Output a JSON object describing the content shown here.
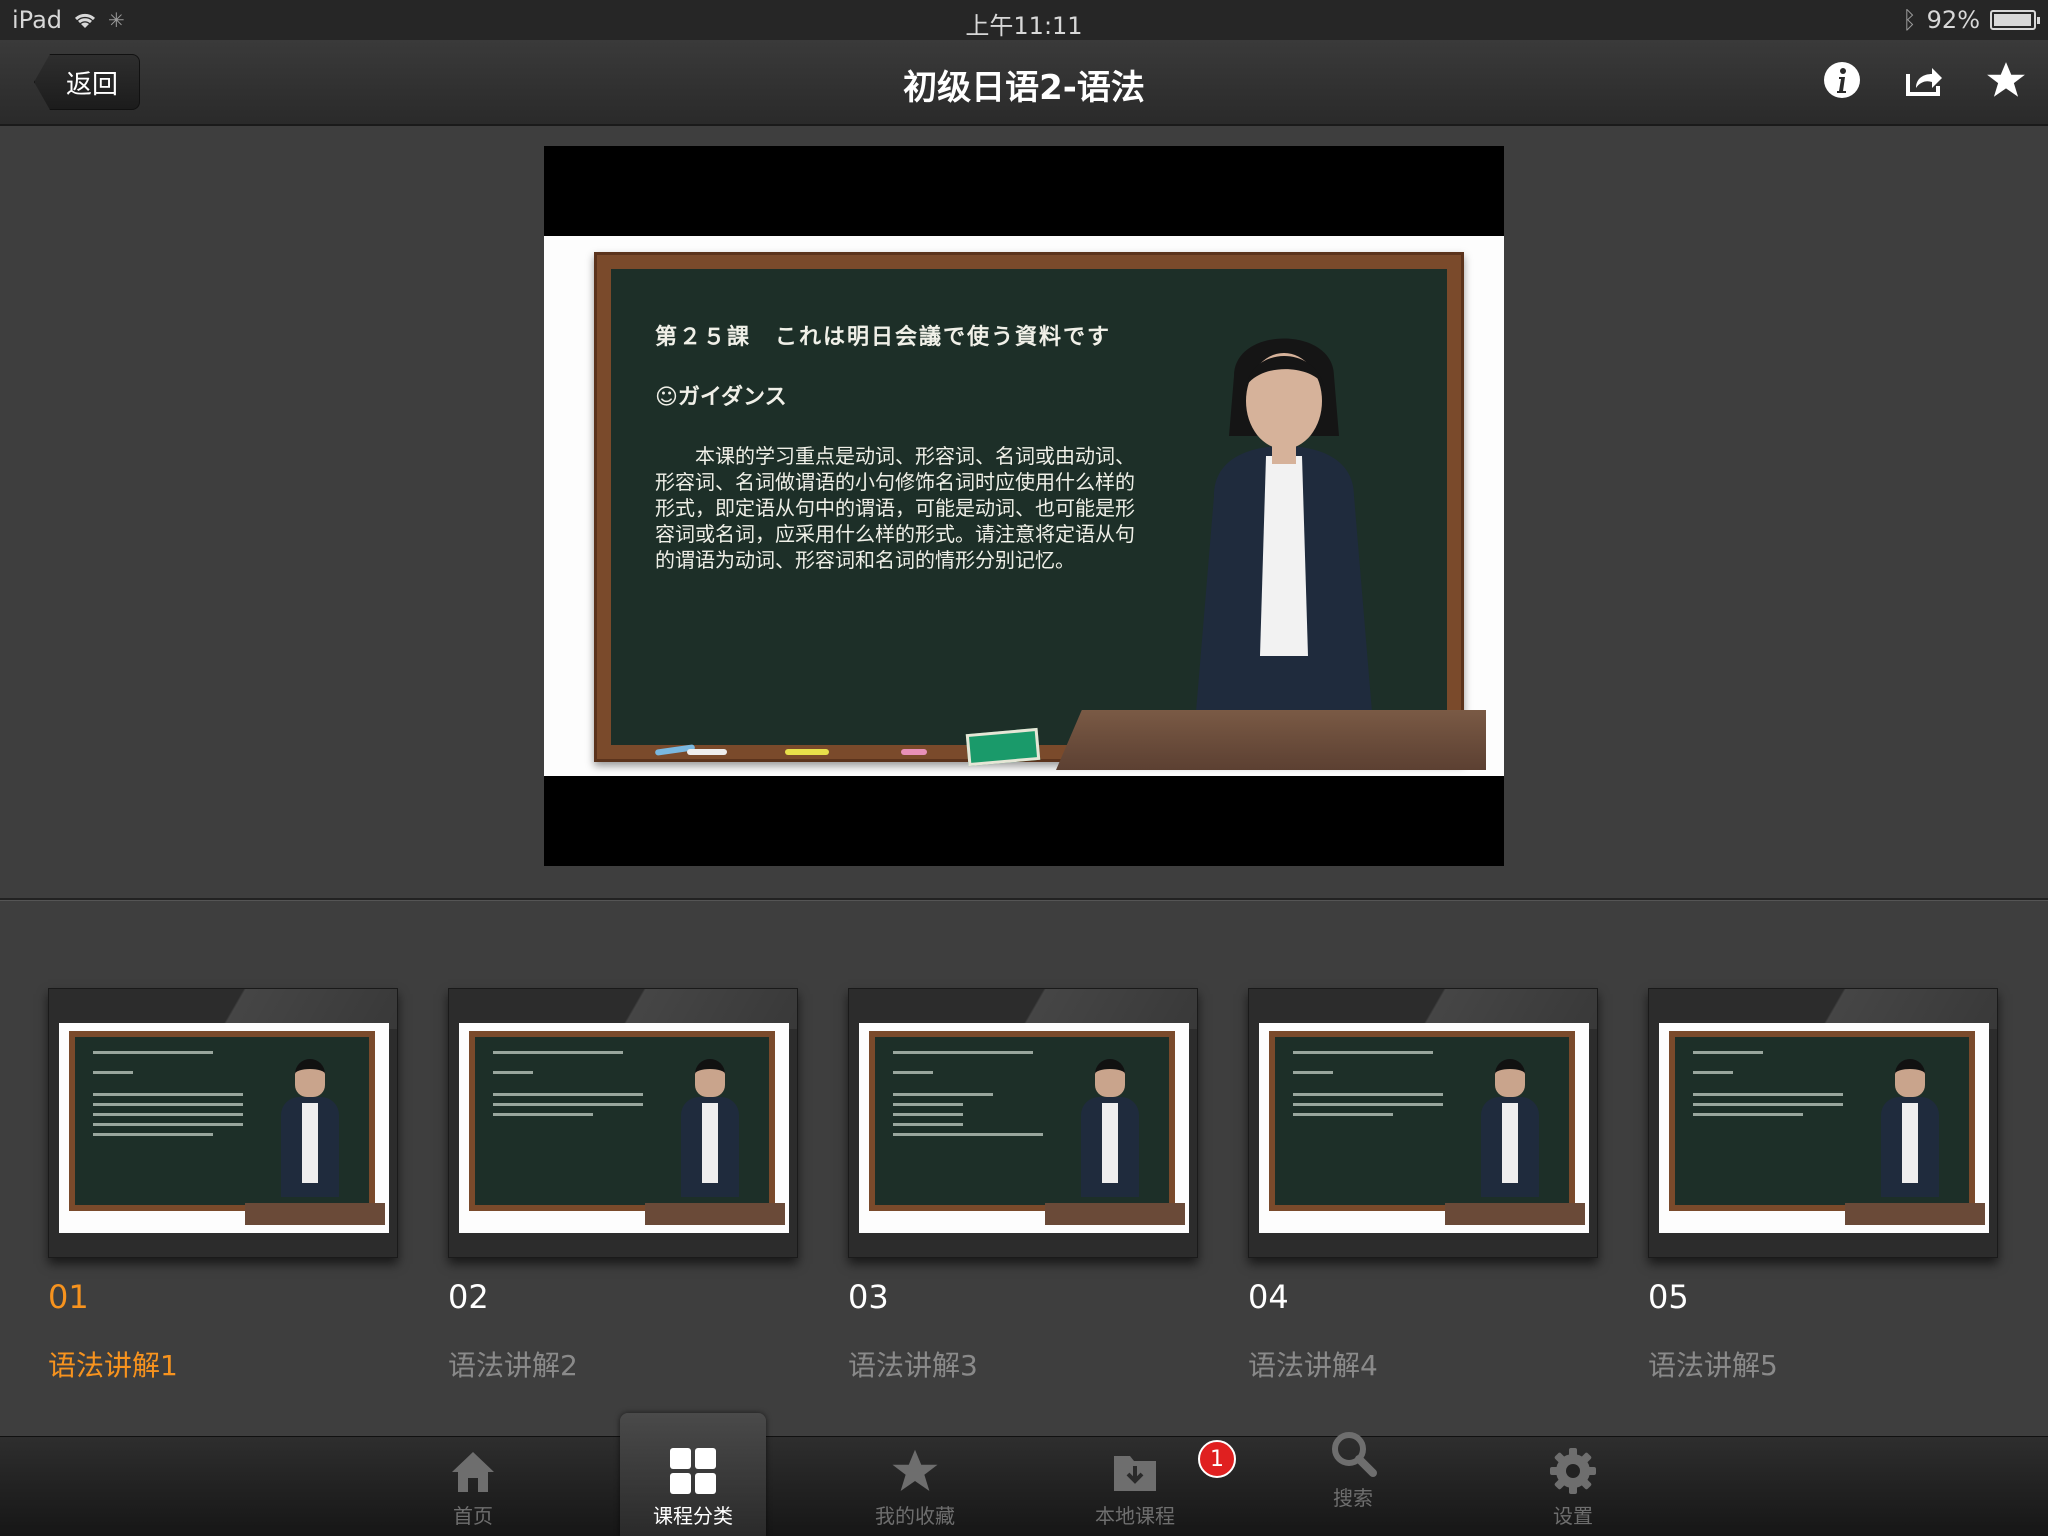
{
  "status_bar": {
    "device": "iPad",
    "time": "上午11:11",
    "battery": "92%",
    "battery_level": 0.92
  },
  "navbar": {
    "back_label": "返回",
    "title": "初级日语2-语法",
    "icons": [
      "info-icon",
      "share-icon",
      "star-icon"
    ]
  },
  "video": {
    "board_title": "第２５課　これは明日会議で使う資料です",
    "board_subtitle": "☺ガイダンス",
    "board_body": "　　本课的学习重点是动词、形容词、名词或由动词、形容词、名词做谓语的小句修饰名词时应使用什么样的形式，即定语从句中的谓语，可能是动词、也可能是形容词或名词，应采用什么样的形式。请注意将定语从句的谓语为动词、形容词和名词的情形分别记忆。"
  },
  "lessons": [
    {
      "num": "01",
      "name": "语法讲解1",
      "active": true
    },
    {
      "num": "02",
      "name": "语法讲解2",
      "active": false
    },
    {
      "num": "03",
      "name": "语法讲解3",
      "active": false
    },
    {
      "num": "04",
      "name": "语法讲解4",
      "active": false
    },
    {
      "num": "05",
      "name": "语法讲解5",
      "active": false
    }
  ],
  "tabbar": {
    "tabs": [
      {
        "label": "首页",
        "icon": "home-icon"
      },
      {
        "label": "课程分类",
        "icon": "grid-icon",
        "selected": true
      },
      {
        "label": "我的收藏",
        "icon": "star-icon"
      },
      {
        "label": "本地课程",
        "icon": "download-folder-icon"
      },
      {
        "label": "搜索",
        "icon": "search-icon"
      },
      {
        "label": "设置",
        "icon": "gear-icon"
      }
    ],
    "badge_count": "1"
  },
  "colors": {
    "accent": "#f7931e",
    "background": "#3e3e3e",
    "badge": "#e02020"
  }
}
